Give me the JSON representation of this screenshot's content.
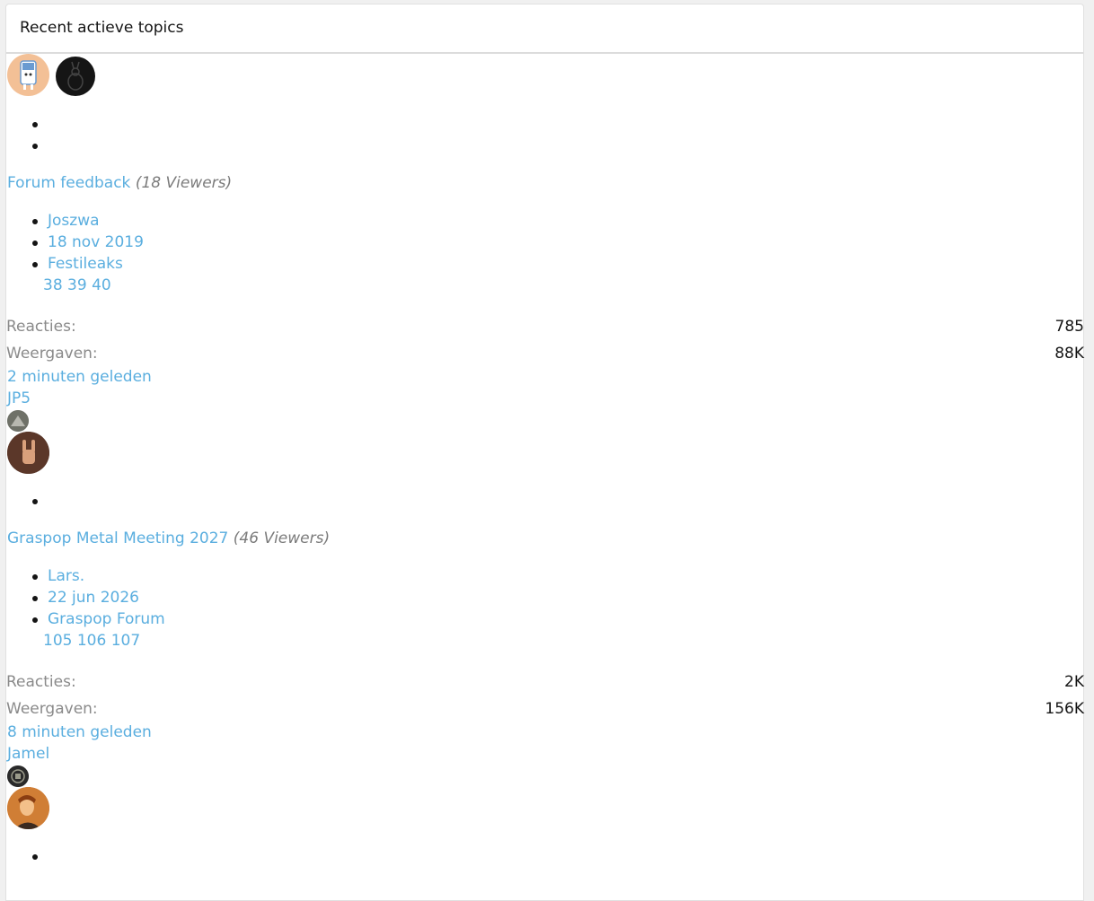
{
  "header": {
    "title": "Recent actieve topics"
  },
  "labels": {
    "replies": "Reacties:",
    "views": "Weergaven:"
  },
  "topics": [
    {
      "title": "Forum feedback",
      "viewers": "(18 Viewers)",
      "author": "Joszwa",
      "date": "18 nov 2019",
      "forum": "Festileaks",
      "pages": "38 39 40",
      "replies": "785",
      "views": "88K",
      "last_time": "2 minuten geleden",
      "last_user": "JP5"
    },
    {
      "title": "Graspop Metal Meeting 2027",
      "viewers": "(46 Viewers)",
      "author": "Lars.",
      "date": "22 jun 2026",
      "forum": "Graspop Forum",
      "pages": "105 106 107",
      "replies": "2K",
      "views": "156K",
      "last_time": "8 minuten geleden",
      "last_user": "Jamel"
    }
  ]
}
